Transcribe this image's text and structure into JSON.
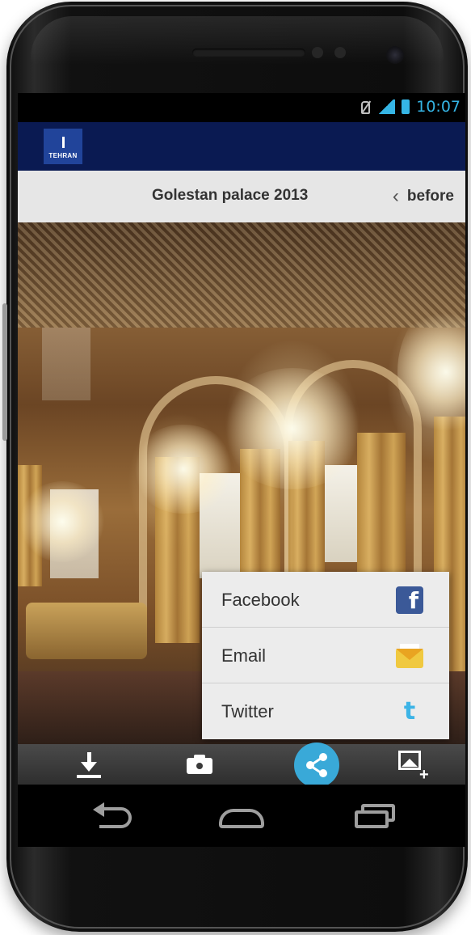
{
  "status_bar": {
    "time": "10:07",
    "icons": [
      "mute-icon",
      "signal-icon",
      "battery-icon"
    ],
    "accent_color": "#35b5e5"
  },
  "app_bar": {
    "logo_text": "TEHRAN",
    "background_color": "#0a1a52"
  },
  "title_bar": {
    "title": "Golestan palace 2013",
    "back_label": "before",
    "back_icon": "chevron-left-icon"
  },
  "photo": {
    "subject": "mirrored palace hall with chandeliers"
  },
  "share_menu": {
    "items": [
      {
        "label": "Facebook",
        "icon": "facebook-icon"
      },
      {
        "label": "Email",
        "icon": "email-icon"
      },
      {
        "label": "Twitter",
        "icon": "twitter-icon"
      }
    ]
  },
  "toolbar": {
    "buttons": [
      "download-icon",
      "camera-icon",
      "share-icon",
      "gallery-add-icon"
    ],
    "share_color": "#39a9d8"
  },
  "nav_bar": {
    "buttons": [
      "back-icon",
      "home-icon",
      "recent-apps-icon"
    ]
  }
}
